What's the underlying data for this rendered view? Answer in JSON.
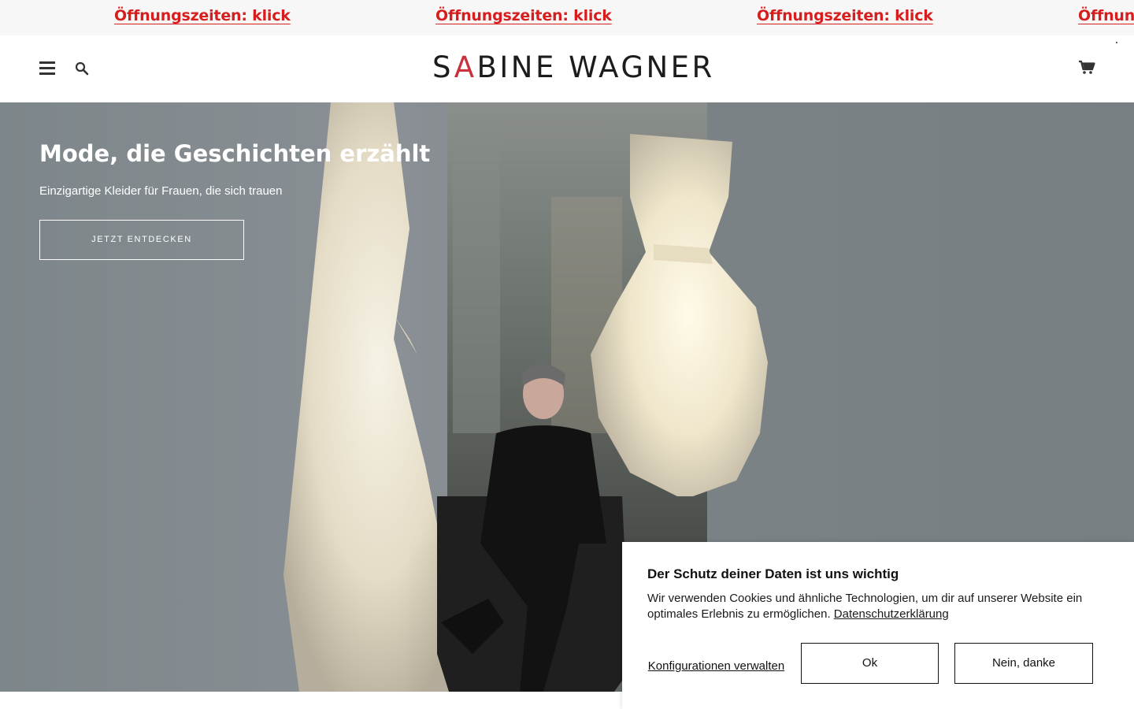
{
  "announcement": {
    "items": [
      "Öffnungszeiten: klick",
      "Öffnungszeiten: klick",
      "Öffnungszeiten: klick",
      "Öffnung"
    ]
  },
  "header": {
    "logo_pre": "S",
    "logo_accent": "A",
    "logo_post": "BINE WAGNER",
    "menu_icon": "hamburger-icon",
    "search_icon": "search-icon",
    "cart_icon": "cart-icon"
  },
  "hero": {
    "title": "Mode, die Geschichten erzählt",
    "subtitle": "Einzigartige Kleider für Frauen, die sich trauen",
    "button": "JETZT ENTDECKEN"
  },
  "cookie": {
    "title": "Der Schutz deiner Daten ist uns wichtig",
    "text": "Wir verwenden Cookies und ähnliche Technologien, um dir auf unserer Website ein optimales Erlebnis zu ermöglichen.",
    "link": "Datenschutzerklärung",
    "config_label": "Konfigurationen verwalten",
    "ok_label": "Ok",
    "no_label": "Nein, danke"
  },
  "colors": {
    "announcement_text": "#d71e1e",
    "logo_accent": "#c8323c",
    "hero_bg": "#7c8489"
  }
}
